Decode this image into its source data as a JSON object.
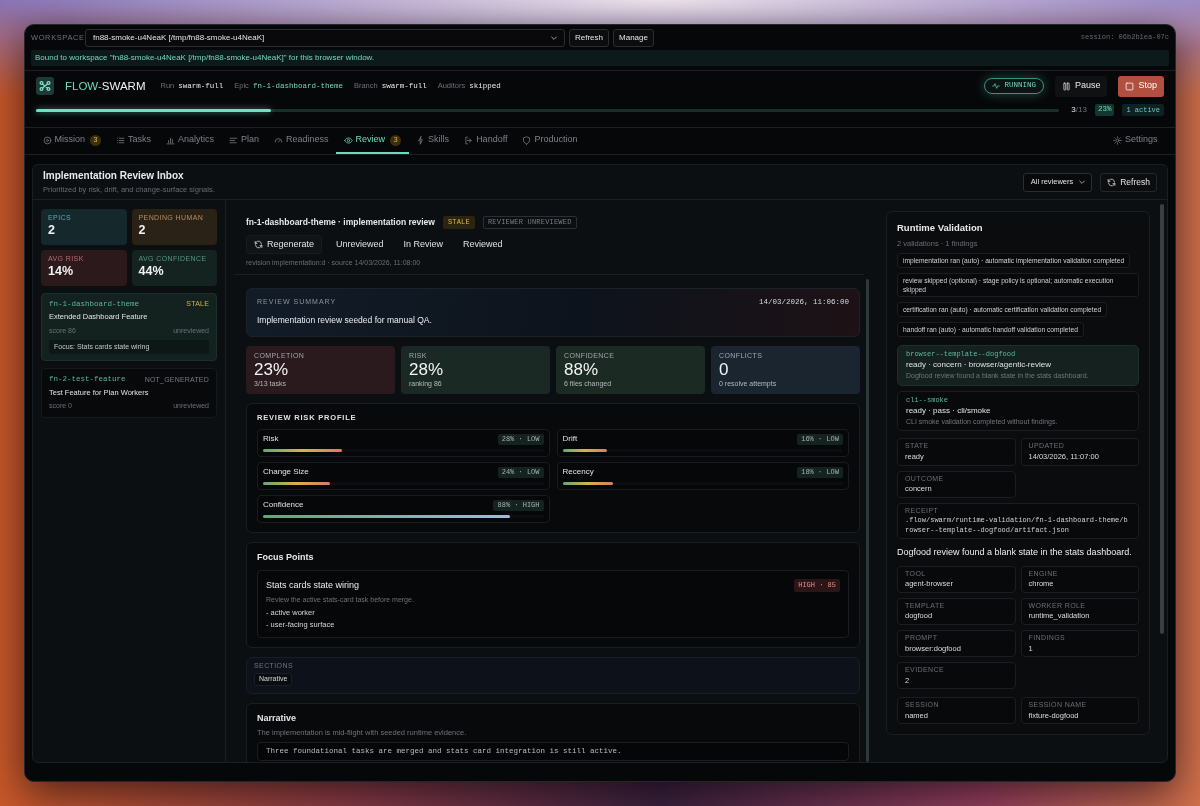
{
  "workspace_bar": {
    "label": "WORKSPACE",
    "workspace": "fn88-smoke-u4NeaK [/tmp/fn88-smoke-u4NeaK]",
    "buttons": [
      "Refresh",
      "Manage"
    ],
    "session": "session: 06b2b1ea-07c"
  },
  "banner": "Bound to workspace \"fn88-smoke-u4NeaK [/tmp/fn88-smoke-u4NeaK]\" for this browser window.",
  "header": {
    "brand": {
      "lead": "FLOW-",
      "tail": "SWARM"
    },
    "meta": [
      {
        "label": "Run",
        "value": "swarm-full",
        "accent": false
      },
      {
        "label": "Epic",
        "value": "fn-1-dashboard-theme",
        "accent": true
      },
      {
        "label": "Branch",
        "value": "swarm-full",
        "accent": false
      },
      {
        "label": "Auditors",
        "value": "skipped",
        "accent": false
      }
    ],
    "status": "RUNNING",
    "buttons": [
      {
        "label": "Pause",
        "kind": "pause"
      },
      {
        "label": "Stop",
        "kind": "stop"
      }
    ]
  },
  "progress": {
    "level": 0.23,
    "done": "3",
    "of": "/13",
    "percent": "23%",
    "active": "1 active"
  },
  "tabs": [
    {
      "label": "Mission",
      "count": "3",
      "selected": false
    },
    {
      "label": "Tasks",
      "selected": false
    },
    {
      "label": "Analytics",
      "selected": false
    },
    {
      "label": "Plan",
      "selected": false
    },
    {
      "label": "Readiness",
      "selected": false
    },
    {
      "label": "Review",
      "count": "3",
      "selected": true
    },
    {
      "label": "Skills",
      "selected": false
    },
    {
      "label": "Handoff",
      "selected": false
    },
    {
      "label": "Production",
      "selected": false
    }
  ],
  "settings": "Settings",
  "inbox": {
    "title": "Implementation Review Inbox",
    "subtitle": "Prioritized by risk, drift, and change-surface signals.",
    "filter": "All reviewers",
    "refresh": "Refresh",
    "stats": [
      {
        "label": "EPICS",
        "value": "2",
        "color": "#15282b"
      },
      {
        "label": "PENDING HUMAN",
        "value": "2",
        "color": "#2a2117"
      },
      {
        "label": "AVG RISK",
        "value": "14%",
        "color": "#2b191b"
      },
      {
        "label": "AVG CONFIDENCE",
        "value": "44%",
        "color": "#14231f"
      }
    ],
    "items": [
      {
        "epic": "fn-1-dashboard-theme",
        "badge": {
          "text": "STALE",
          "kind": "warning"
        },
        "title": "Extended Dashboard Feature",
        "score": "score 86",
        "state": "unreviewed",
        "focus": "Focus: Stats cards state wiring",
        "selected": true
      },
      {
        "epic": "fn-2-test-feature",
        "badge": {
          "text": "NOT_GENERATED",
          "kind": "muted"
        },
        "title": "Test Feature for Plan Workers",
        "score": "score 0",
        "state": "unreviewed",
        "selected": false
      }
    ]
  },
  "review": {
    "title": "fn-1-dashboard-theme · implementation review",
    "badges": [
      {
        "text": "STALE",
        "kind": "filled",
        "color": "#2b2410"
      },
      {
        "text": "REVIEWER UNREVIEWED",
        "kind": "outline",
        "color": "#2c3034"
      }
    ],
    "actions": [
      {
        "label": "Regenerate",
        "kind": "regenerate"
      },
      {
        "label": "Unreviewed",
        "kind": "status"
      },
      {
        "label": "In Review",
        "kind": "status"
      },
      {
        "label": "Reviewed",
        "kind": "status"
      }
    ],
    "revision": "revision implementation:d · source 14/03/2026, 11:08:00",
    "summary": {
      "label": "REVIEW SUMMARY",
      "time": "14/03/2026, 11:06:00",
      "text": "Implementation review seeded for manual QA."
    },
    "metrics": [
      {
        "label": "COMPLETION",
        "value": "23%",
        "note": "3/13 tasks",
        "color": "#2a191d"
      },
      {
        "label": "RISK",
        "value": "28%",
        "note": "ranking 86",
        "color": "#1b2925"
      },
      {
        "label": "CONFIDENCE",
        "value": "88%",
        "note": "6 files changed",
        "color": "#1c2a24"
      },
      {
        "label": "CONFLICTS",
        "value": "0",
        "note": "0 resolve attempts",
        "color": "#1a2530"
      }
    ],
    "risk_profile": {
      "title": "REVIEW RISK PROFILE",
      "items": [
        {
          "label": "Risk",
          "reading": "28% · LOW",
          "level": 0.28,
          "kind": "risk"
        },
        {
          "label": "Drift",
          "reading": "16% · LOW",
          "level": 0.16,
          "kind": "risk"
        },
        {
          "label": "Change Size",
          "reading": "24% · LOW",
          "level": 0.24,
          "kind": "risk"
        },
        {
          "label": "Recency",
          "reading": "18% · LOW",
          "level": 0.18,
          "kind": "risk"
        },
        {
          "label": "Confidence",
          "reading": "88% · HIGH",
          "level": 0.88,
          "kind": "confidence"
        }
      ]
    },
    "focus_points": {
      "title": "Focus Points",
      "items": [
        {
          "title": "Stats cards state wiring",
          "badge": "HIGH · 85",
          "text": "Review the active stats-card task before merge.",
          "bullets": [
            "- active worker",
            "- user-facing surface"
          ]
        }
      ]
    },
    "sections": {
      "label": "SECTIONS",
      "chips": [
        "Narrative"
      ]
    },
    "narrative": {
      "title": "Narrative",
      "text": "The implementation is mid-flight with seeded runtime evidence.",
      "code": "Three foundational tasks are merged and stats card integration is still active."
    }
  },
  "runtime": {
    "title": "Runtime Validation",
    "subtitle": "2 validations · 1 findings",
    "checks": [
      "implementation ran (auto) · automatic implementation validation completed",
      "review skipped (optional) · stage policy is optional; automatic execution skipped",
      "certification ran (auto) · automatic certification validation completed",
      "handoff ran (auto) · automatic handoff validation completed"
    ],
    "validations": [
      {
        "name": "browser--template--dogfood",
        "meta": "ready · concern · browser/agentic-review",
        "text": "Dogfood review found a blank state in the stats dashboard.",
        "selected": true
      },
      {
        "name": "cli--smoke",
        "meta": "ready · pass · cli/smoke",
        "text": "CLI smoke validation completed without findings.",
        "selected": false
      }
    ],
    "status_fields": [
      {
        "label": "STATE",
        "value": "ready"
      },
      {
        "label": "UPDATED",
        "value": "14/03/2026, 11:07:00"
      },
      {
        "label": "OUTCOME",
        "value": "concern"
      }
    ],
    "receipt": {
      "label": "RECEIPT",
      "value": ".flow/swarm/runtime-validation/fn-1-dashboard-theme/browser--template--dogfood/artifact.json"
    },
    "finding": "Dogfood review found a blank state in the stats dashboard.",
    "tool_fields": [
      {
        "label": "TOOL",
        "value": "agent-browser"
      },
      {
        "label": "ENGINE",
        "value": "chrome"
      },
      {
        "label": "TEMPLATE",
        "value": "dogfood"
      },
      {
        "label": "WORKER ROLE",
        "value": "runtime_validation"
      },
      {
        "label": "PROMPT",
        "value": "browser:dogfood"
      },
      {
        "label": "FINDINGS",
        "value": "1"
      },
      {
        "label": "EVIDENCE",
        "value": "2"
      }
    ],
    "session_fields": [
      {
        "label": "SESSION",
        "value": "named"
      },
      {
        "label": "SESSION NAME",
        "value": "fixture-dogfood"
      }
    ]
  }
}
